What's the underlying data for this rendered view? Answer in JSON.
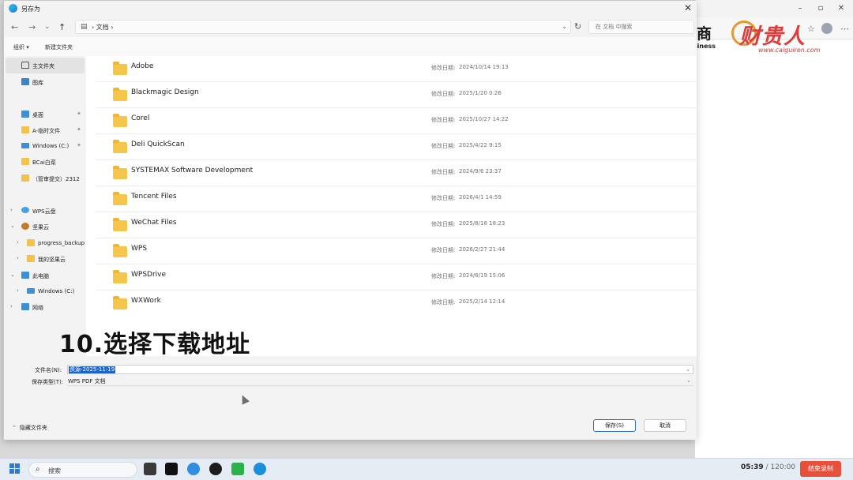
{
  "dialog": {
    "title": "另存为",
    "close_glyph": "✕"
  },
  "nav": {
    "back": "←",
    "forward": "→",
    "recent": "⌄",
    "up": "↑",
    "breadcrumb": "文档",
    "refresh": "↻",
    "search_placeholder": "在 文档 中搜索"
  },
  "cmd": {
    "organize": "组织 ▾",
    "new_folder": "新建文件夹"
  },
  "sidebar": {
    "items": [
      {
        "label": "主文件夹",
        "icon": "home-icon"
      },
      {
        "label": "图库",
        "icon": "gallery-icon"
      },
      {
        "label": "桌面",
        "icon": "desktop-icon"
      },
      {
        "label": "A-临时文件",
        "icon": "folder-icon"
      },
      {
        "label": "Windows (C:)",
        "icon": "drive-icon"
      },
      {
        "label": "BCai白菜",
        "icon": "folder-icon"
      },
      {
        "label": "（管审提交）2312",
        "icon": "folder-icon"
      },
      {
        "label": "WPS云盘",
        "icon": "cloud-icon"
      },
      {
        "label": "坚果云",
        "icon": "nut-icon"
      },
      {
        "label": "progress_backup",
        "icon": "folder-icon"
      },
      {
        "label": "我的坚果云",
        "icon": "folder-icon"
      },
      {
        "label": "此电脑",
        "icon": "pc-icon"
      },
      {
        "label": "Windows (C:)",
        "icon": "drive-icon"
      },
      {
        "label": "网络",
        "icon": "network-icon"
      }
    ]
  },
  "files": {
    "date_label": "修改日期:",
    "rows": [
      {
        "name": "Adobe",
        "date": "2024/10/14 19:13"
      },
      {
        "name": "Blackmagic Design",
        "date": "2025/1/20 0:26"
      },
      {
        "name": "Corel",
        "date": "2025/10/27 14:22"
      },
      {
        "name": "Deli QuickScan",
        "date": "2025/4/22 9:15"
      },
      {
        "name": "SYSTEMAX Software Development",
        "date": "2024/9/6 23:37"
      },
      {
        "name": "Tencent Files",
        "date": "2026/4/1 14:59"
      },
      {
        "name": "WeChat Files",
        "date": "2025/8/18 18:23"
      },
      {
        "name": "WPS",
        "date": "2026/2/27 21:44"
      },
      {
        "name": "WPSDrive",
        "date": "2024/8/19 15:06"
      },
      {
        "name": "WXWork",
        "date": "2025/2/14 12:14"
      }
    ]
  },
  "overlay": {
    "caption": "10.选择下载地址"
  },
  "form": {
    "filename_label": "文件名(N):",
    "filename_value": "资源-2025-11-19",
    "filetype_label": "保存类型(T):",
    "filetype_value": "WPS PDF 文档",
    "dropdown_glyph": "⌄"
  },
  "footer": {
    "hide_folders": "隐藏文件夹",
    "save": "保存(S)",
    "cancel": "取消"
  },
  "logos": {
    "jiangnan_cn": "江南工商",
    "jiangnan_en": "Jiangnan Business",
    "caiguiren_cn": "财贵人",
    "caiguiren_url": "www.caiguiren.com"
  },
  "taskbar": {
    "search_label": "搜索",
    "rec_elapsed": "05:39",
    "rec_total": " / 120:00",
    "rec_button": "结束录制"
  },
  "colors": {
    "accent": "#1f64c8",
    "folder": "#f6c54b",
    "record": "#e8503a"
  }
}
